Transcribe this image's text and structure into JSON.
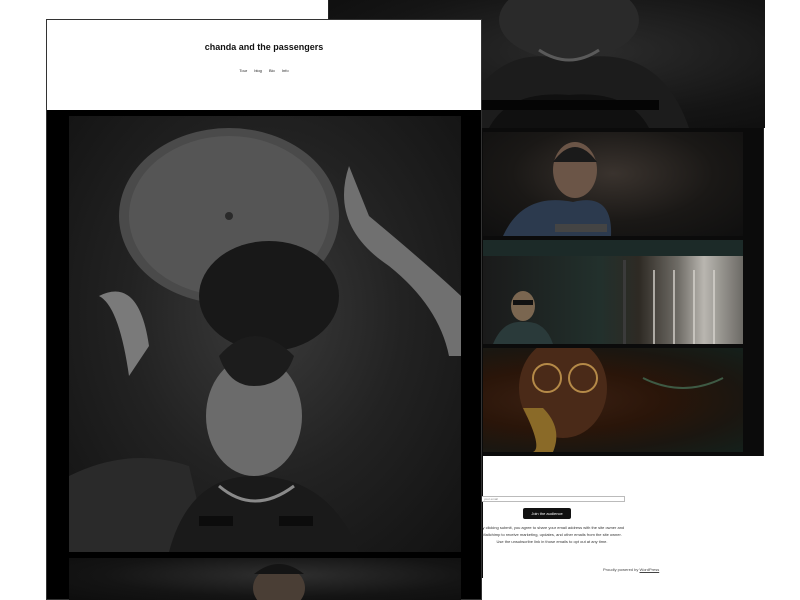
{
  "front": {
    "site_title": "chanda and the passengers",
    "nav": [
      "Tour",
      "blog",
      "Bio",
      "Info"
    ]
  },
  "back": {
    "subscribe": {
      "placeholder": "your email",
      "button_label": "Join the audience",
      "consent_text": "By clicking submit, you agree to share your email address with the site owner and Mailchimp to receive marketing, updates, and other emails from the site owner. Use the unsubscribe link in those emails to opt out at any time."
    },
    "footer": {
      "powered_prefix": "Proudly powered by",
      "powered_link": "WordPress"
    }
  }
}
